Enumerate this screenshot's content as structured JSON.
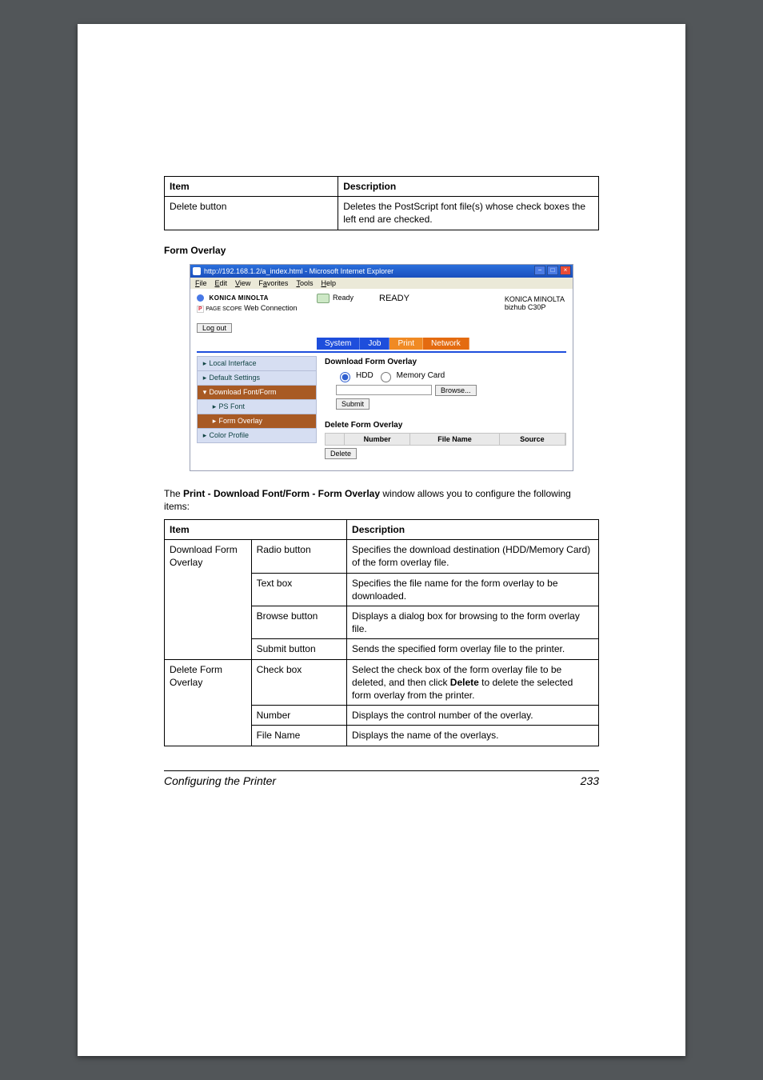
{
  "top_table": {
    "h_item": "Item",
    "h_desc": "Description",
    "r1_item": "Delete button",
    "r1_desc": "Deletes the PostScript font file(s) whose check boxes the left end are checked."
  },
  "section_heading": "Form Overlay",
  "screenshot": {
    "titlebar": "http://192.168.1.2/a_index.html - Microsoft Internet Explorer",
    "menus": {
      "file": "File",
      "edit": "Edit",
      "view": "View",
      "fav": "Favorites",
      "tools": "Tools",
      "help": "Help"
    },
    "brand_name": "KONICA MINOLTA",
    "web_sub_prefix": "PAGE SCOPE",
    "web_sub": "Web Connection",
    "status_icon_label": "Ready",
    "status_big": "READY",
    "right1": "KONICA MINOLTA",
    "right2": "bizhub C30P",
    "logout": "Log out",
    "tabs": {
      "system": "System",
      "job": "Job",
      "print": "Print",
      "network": "Network"
    },
    "sidebar": {
      "local": "Local Interface",
      "defaults": "Default Settings",
      "download": "Download Font/Form",
      "psfont": "PS Font",
      "formoverlay": "Form Overlay",
      "color": "Color Profile"
    },
    "panel": {
      "heading_download": "Download Form Overlay",
      "radio_hdd": "HDD",
      "radio_mem": "Memory Card",
      "browse": "Browse...",
      "submit": "Submit",
      "heading_delete": "Delete Form Overlay",
      "col_number": "Number",
      "col_filename": "File Name",
      "col_source": "Source",
      "delete": "Delete"
    }
  },
  "caption": {
    "pre": "The ",
    "bold": "Print - Download Font/Form - Form Overlay",
    "post": " window allows you to configure the following items:"
  },
  "main_table": {
    "h_item": "Item",
    "h_desc": "Description",
    "g1_name": "Download Form Overlay",
    "g1_r1_sub": "Radio button",
    "g1_r1_desc": "Specifies the download destination (HDD/Memory Card) of the form overlay file.",
    "g1_r2_sub": "Text box",
    "g1_r2_desc": "Specifies the file name for the form overlay to be downloaded.",
    "g1_r3_sub": "Browse button",
    "g1_r3_desc": "Displays a dialog box for browsing to the form overlay file.",
    "g1_r4_sub": "Submit button",
    "g1_r4_desc": "Sends the specified form overlay file to the printer.",
    "g2_name": "Delete Form Overlay",
    "g2_r1_sub": "Check box",
    "g2_r1_desc_pre": "Select the check box of the form overlay file to be deleted, and then click ",
    "g2_r1_desc_bold": "Delete",
    "g2_r1_desc_post": " to delete the selected form overlay from the printer.",
    "g2_r2_sub": "Number",
    "g2_r2_desc": "Displays the control number of the overlay.",
    "g2_r3_sub": "File Name",
    "g2_r3_desc": "Displays the name of the overlays."
  },
  "footer": {
    "left": "Configuring the Printer",
    "right": "233"
  }
}
